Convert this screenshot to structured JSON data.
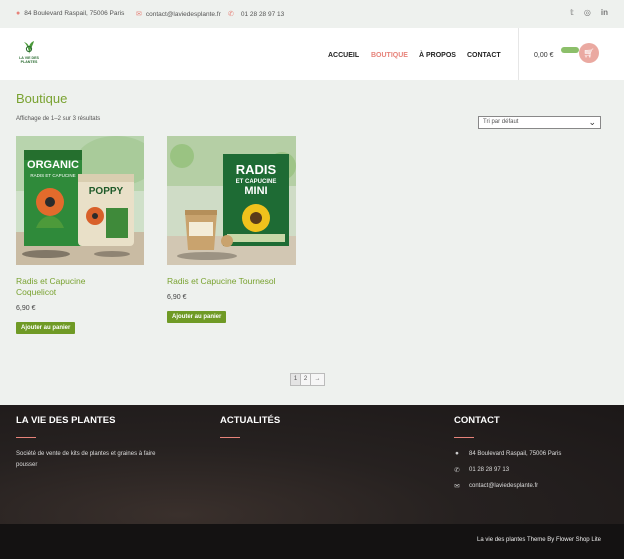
{
  "topbar": {
    "address": "84 Boulevard Raspail, 75006 Paris",
    "email": "contact@laviedesplante.fr",
    "phone": "01 28 28 97 13",
    "social_icons": [
      "twitter-icon",
      "instagram-icon",
      "linkedin-icon"
    ]
  },
  "header": {
    "logo_text": "LA VIE DES PLANTES",
    "nav": [
      "ACCUEIL",
      "BOUTIQUE",
      "À PROPOS",
      "CONTACT"
    ],
    "active_nav": "BOUTIQUE",
    "cart_amount": "0,00 €"
  },
  "main": {
    "title": "Boutique",
    "result_count": "Affichage de 1–2 sur 3 résultats",
    "sort_selected": "Tri par défaut"
  },
  "products": [
    {
      "name_line1": "Radis et Capucine",
      "name_line2": "Coquelicot",
      "price": "6,90 €",
      "button": "Ajouter au panier",
      "pack_text_1": "ORGANIC",
      "pack_text_2": "RADIS ET CAPUCINE",
      "pack_text_3": "POPPY"
    },
    {
      "name_line1": "Radis et Capucine Tournesol",
      "name_line2": "",
      "price": "6,90 €",
      "button": "Ajouter au panier",
      "pack_text_1": "RADIS",
      "pack_text_2": "ET CAPUCINE",
      "pack_text_3": "MINI"
    }
  ],
  "pagination": {
    "pages": [
      "1",
      "2"
    ],
    "next": "→",
    "current": "1"
  },
  "footer": {
    "col1_title": "LA VIE DES PLANTES",
    "col1_text": "Société de vente de kits de plantes et graines à faire pousser",
    "col2_title": "ACTUALITÉS",
    "col3_title": "CONTACT",
    "address": "84 Boulevard Raspail, 75006 Paris",
    "phone": "01 28 28 97 13",
    "email": "contact@laviedesplante.fr",
    "credit": "La vie des plantes Theme By Flower Shop Lite"
  },
  "colors": {
    "accent_green": "#79a230",
    "button_green": "#6f9a25",
    "accent_pink": "#e7837a"
  }
}
